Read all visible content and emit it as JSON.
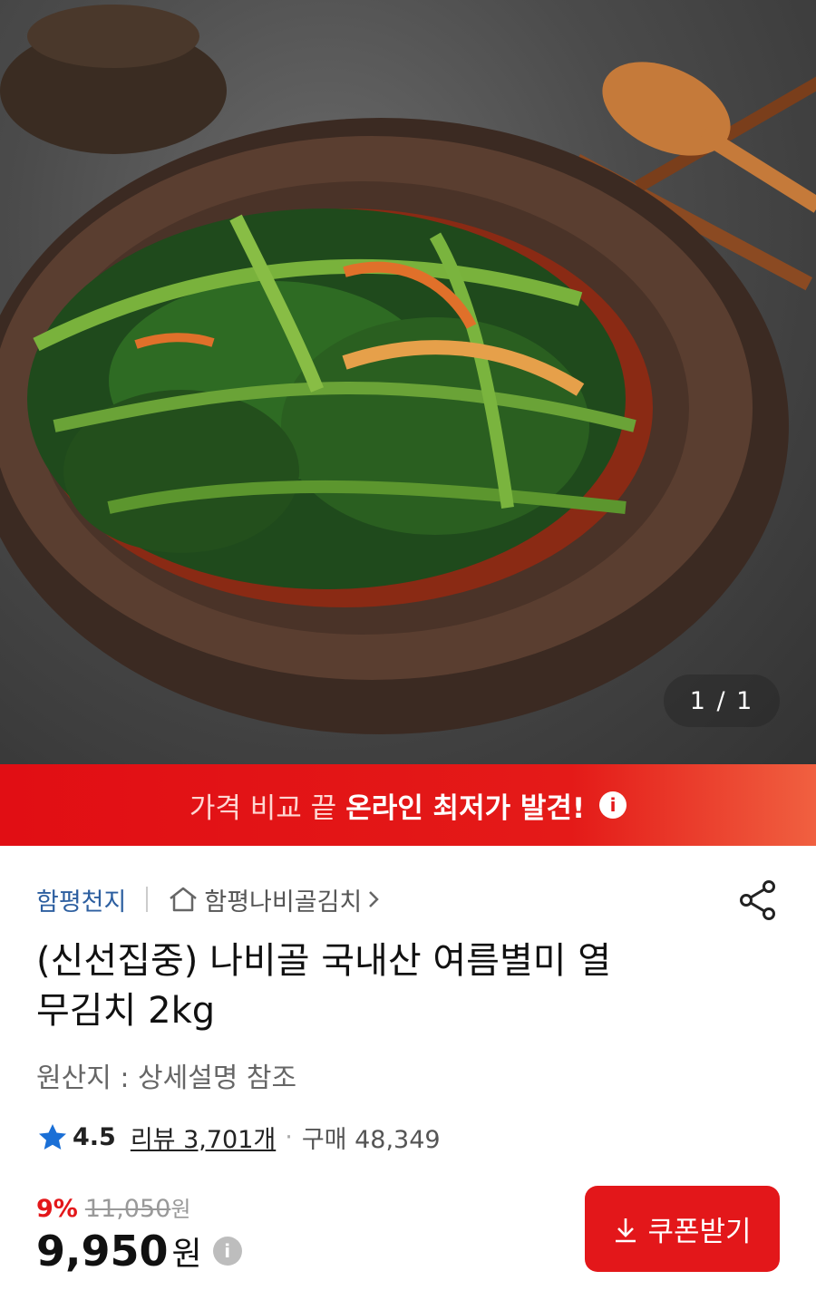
{
  "gallery": {
    "counter": "1 / 1"
  },
  "banner": {
    "text_light": "가격 비교 끝",
    "text_bold": "온라인 최저가 발견!"
  },
  "seller": {
    "store_name": "함평천지",
    "shop_link": "함평나비골김치"
  },
  "product": {
    "title_line1": "(신선집중) 나비골 국내산 여름별미 열",
    "title_line2": "무김치 2kg",
    "origin": "원산지 : 상세설명 참조"
  },
  "rating": {
    "score": "4.5",
    "review_label": "리뷰 3,701개",
    "purchase_label": "구매 48,349"
  },
  "price": {
    "discount": "9%",
    "original": "11,050",
    "original_unit": "원",
    "final": "9,950",
    "final_unit": "원"
  },
  "coupon": {
    "label": "쿠폰받기"
  },
  "colors": {
    "accent": "#e3171a",
    "link": "#2d5fa0"
  }
}
